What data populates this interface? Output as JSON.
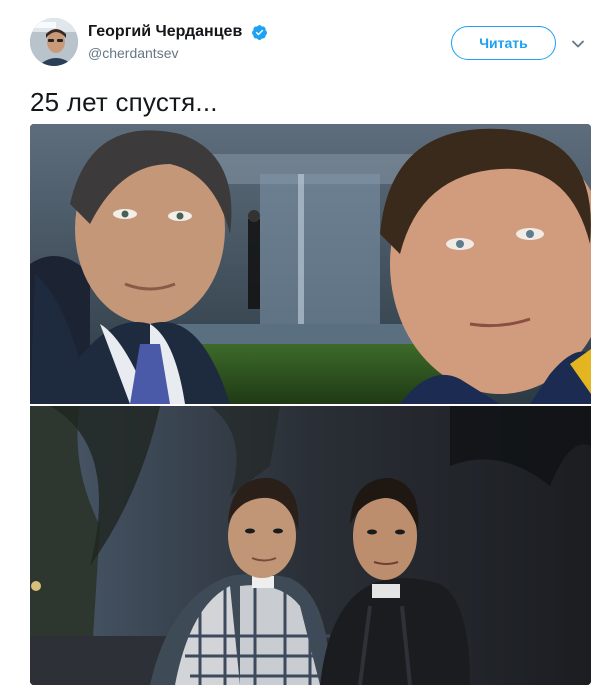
{
  "author": {
    "display_name": "Георгий Черданцев",
    "handle": "@cherdantsev",
    "verified": true,
    "avatar_icon": "profile-photo"
  },
  "actions": {
    "follow_label": "Читать",
    "more_icon": "chevron-down-icon"
  },
  "tweet": {
    "text": "25 лет спустя..."
  },
  "media": {
    "photo_count": 2,
    "photo_1_desc_icon": "photo-recent-selfie",
    "photo_2_desc_icon": "photo-old-print"
  },
  "colors": {
    "accent": "#1da1f2",
    "text_primary": "#14171a",
    "text_secondary": "#657786"
  }
}
